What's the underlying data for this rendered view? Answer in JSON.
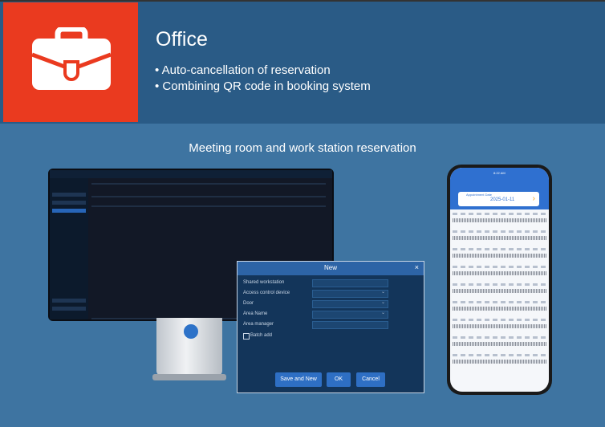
{
  "header": {
    "title": "Office",
    "bullets": [
      "• Auto-cancellation of reservation",
      "• Combining QR code in booking system"
    ]
  },
  "caption": "Meeting room and work station reservation",
  "dialog": {
    "title": "New",
    "close": "×",
    "fields": [
      "Shared workstation",
      "Access control device",
      "Door",
      "Area Name",
      "Area manager"
    ],
    "checkbox": "Batch add",
    "buttons": [
      "Save and New",
      "OK",
      "Cancel"
    ]
  },
  "phone": {
    "time": "8:22 AM",
    "card_label": "Appointment Date",
    "date": "2025-01-11",
    "arrow": "›"
  },
  "colors": {
    "header_bg": "#2a5b86",
    "icon_bg": "#ea3a1f",
    "body_bg": "#3e74a1",
    "accent_blue": "#2e6fc4"
  }
}
